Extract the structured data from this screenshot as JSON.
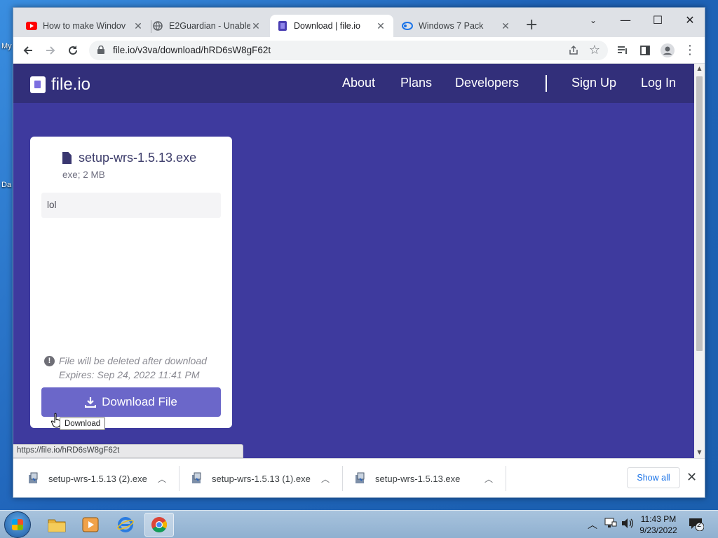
{
  "desktop": {
    "labels": [
      "My",
      "Da"
    ]
  },
  "browser": {
    "tabs": [
      {
        "title": "How to make Windov",
        "icon": "youtube-icon",
        "active": false
      },
      {
        "title": "E2Guardian - Unable",
        "icon": "globe-icon",
        "active": false
      },
      {
        "title": "Download | file.io",
        "icon": "fileio-icon",
        "active": true
      },
      {
        "title": "Windows 7 Pack",
        "icon": "loading-icon",
        "active": false
      }
    ],
    "new_tab": "+",
    "url": "file.io/v3va/download/hRD6sW8gF62t"
  },
  "site": {
    "logo_text": "file.io",
    "nav": {
      "about": "About",
      "plans": "Plans",
      "developers": "Developers",
      "signup": "Sign Up",
      "login": "Log In"
    },
    "colors": {
      "nav_bg": "#322f7a",
      "page_bg": "#3e3a9e",
      "button": "#6b67c9"
    }
  },
  "card": {
    "filename": "setup-wrs-1.5.13.exe",
    "meta": "exe; 2 MB",
    "note": "lol",
    "warning_line1": "File will be deleted after download",
    "warning_line2": "Expires: Sep 24, 2022 11:41 PM",
    "download_label": "Download File",
    "tooltip": "Download"
  },
  "status_url": "https://file.io/hRD6sW8gF62t",
  "downloads": {
    "items": [
      "setup-wrs-1.5.13 (2).exe",
      "setup-wrs-1.5.13 (1).exe",
      "setup-wrs-1.5.13.exe"
    ],
    "show_all": "Show all"
  },
  "taskbar": {
    "time": "11:43 PM",
    "date": "9/23/2022",
    "notification_count": "2"
  }
}
